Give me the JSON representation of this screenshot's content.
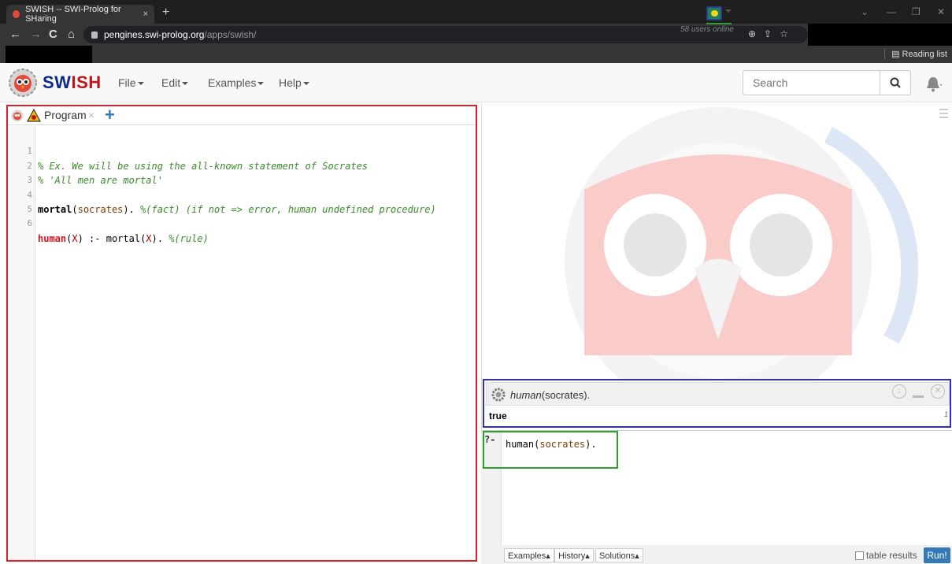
{
  "browser": {
    "tab_title": "SWISH -- SWI-Prolog for SHaring",
    "tab_close": "×",
    "new_tab": "+",
    "url_host": "pengines.swi-prolog.org",
    "url_path": "/apps/swish/",
    "reading_list": "Reading list"
  },
  "navbar": {
    "brand_sw": "SW",
    "brand_ish": "ISH",
    "menus": [
      "File",
      "Edit",
      "Examples",
      "Help"
    ],
    "users_online": "58 users online",
    "search_placeholder": "Search"
  },
  "editor": {
    "tab_label": "Program",
    "tab_close": "×",
    "tab_add": "+",
    "line_numbers": [
      "1",
      "2",
      "3",
      "4",
      "5",
      "6"
    ],
    "lines": {
      "l1": "% Ex. We will be using the all-known statement of Socrates",
      "l2": "% 'All men are mortal'",
      "l4_head": "mortal",
      "l4_open": "(",
      "l4_arg": "socrates",
      "l4_close": "). ",
      "l4_comment": "%(fact) (if not => error, human undefined procedure)",
      "l6_head": "human",
      "l6_open": "(",
      "l6_var": "X",
      "l6_mid": ") :- mortal(",
      "l6_var2": "X",
      "l6_close": "). ",
      "l6_comment": "%(rule)"
    }
  },
  "results": {
    "query_pred": "human",
    "query_rest": "(socrates).",
    "answer": "true",
    "count": "1"
  },
  "query": {
    "prompt": "?-",
    "text_pred": "human(",
    "text_arg": "socrates",
    "text_end": ")."
  },
  "buttons": {
    "examples": "Examples",
    "history": "History",
    "solutions": "Solutions",
    "table_results": "table results",
    "run": "Run!"
  },
  "colors": {
    "editor_border": "#e01e28",
    "results_border": "#2b30c8",
    "query_border": "#2ca02c",
    "brand_blue": "#0b2a8c",
    "brand_red": "#c0141c",
    "run_button": "#337ab7"
  }
}
